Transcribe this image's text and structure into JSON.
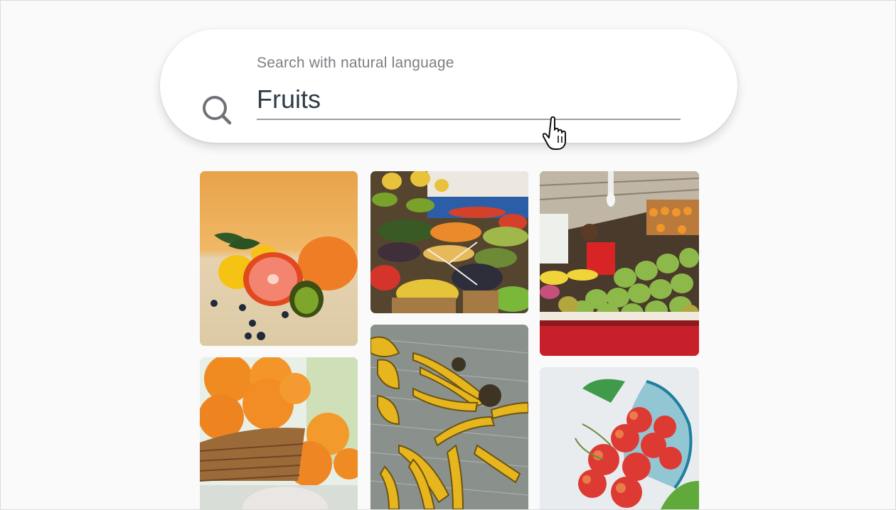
{
  "search": {
    "label": "Search with natural language",
    "value": "Fruits",
    "icon": "search-icon"
  },
  "results": [
    {
      "name": "citrus-still-life"
    },
    {
      "name": "fruit-market-baskets"
    },
    {
      "name": "fruit-stall-vendor"
    },
    {
      "name": "oranges-in-basket"
    },
    {
      "name": "bananas-on-newspaper"
    },
    {
      "name": "cherries-in-glass"
    }
  ],
  "colors": {
    "background": "#fafafa",
    "search_text": "#2f3b46",
    "label_text": "#7a7f85"
  }
}
